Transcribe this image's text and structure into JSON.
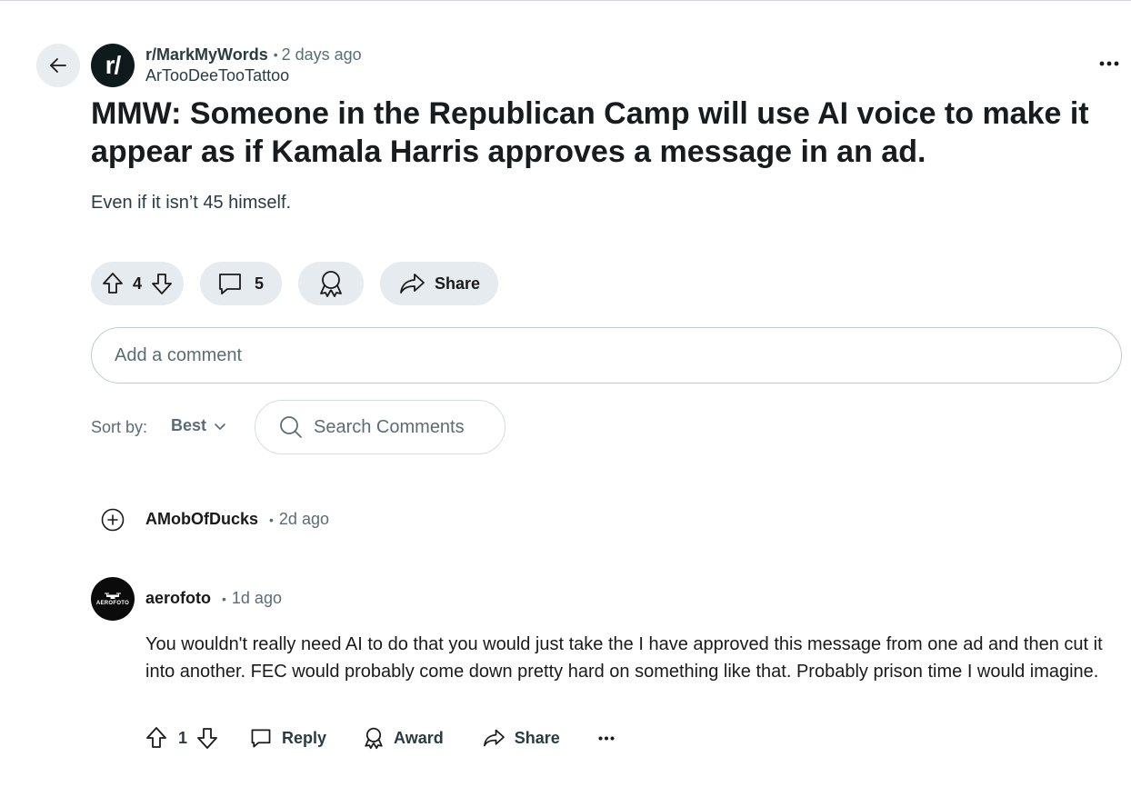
{
  "post": {
    "subreddit": "r/MarkMyWords",
    "subreddit_avatar_text": "r/",
    "separator": "•",
    "time": "2 days ago",
    "author": "ArTooDeeTooTattoo",
    "title": "MMW: Someone in the Republican Camp will use AI voice to make it appear as if Kamala Harris approves a message in an ad.",
    "body": "Even if it isn’t 45 himself.",
    "votes": "4",
    "comments": "5",
    "share_label": "Share"
  },
  "comment_box": {
    "placeholder": "Add a comment"
  },
  "sort": {
    "label": "Sort by:",
    "value": "Best"
  },
  "search": {
    "placeholder": "Search Comments"
  },
  "comments": [
    {
      "author": "AMobOfDucks",
      "separator": "•",
      "time": "2d ago"
    },
    {
      "author": "aerofoto",
      "avatar_text": "AEROFOTO",
      "separator": "•",
      "time": "1d ago",
      "body": "You wouldn't really need AI to do that you would just take the I have approved this message from one ad and then cut it into another. FEC would probably come down pretty hard on something like that. Probably prison time I would imagine.",
      "votes": "1",
      "reply_label": "Reply",
      "award_label": "Award",
      "share_label": "Share"
    }
  ]
}
